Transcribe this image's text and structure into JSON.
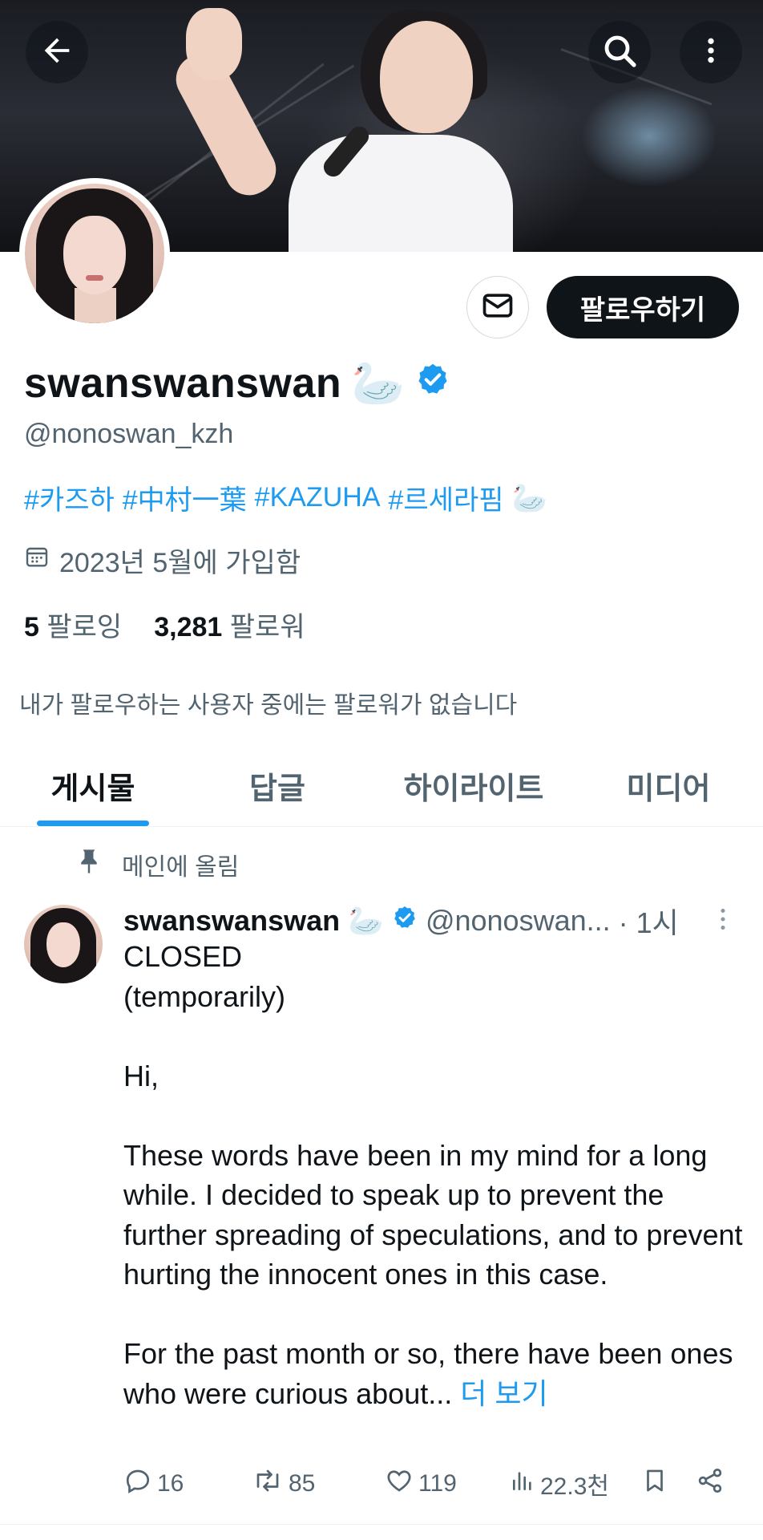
{
  "profile": {
    "display_name": "swanswanswan",
    "name_emoji": "🦢",
    "handle": "@nonoswan_kzh",
    "bio_tags": [
      "#카즈하",
      "#中村一葉",
      "#KAZUHA",
      "#르세라핌"
    ],
    "bio_emoji": "🦢",
    "joined": "2023년 5월에 가입함",
    "following_count": "5",
    "following_label": "팔로잉",
    "followers_count": "3,281",
    "followers_label": "팔로워",
    "mutual_note": "내가 팔로우하는 사용자 중에는 팔로워가 없습니다",
    "follow_button": "팔로우하기",
    "verified_color": "#1d9bf0"
  },
  "icons": {
    "back": "back-arrow-icon",
    "search": "search-icon",
    "more": "more-vertical-icon",
    "mail": "mail-icon",
    "calendar": "calendar-icon",
    "pin": "pin-icon",
    "verified": "verified-badge-icon"
  },
  "tabs": [
    {
      "label": "게시물",
      "active": true
    },
    {
      "label": "답글",
      "active": false
    },
    {
      "label": "하이라이트",
      "active": false
    },
    {
      "label": "미디어",
      "active": false
    }
  ],
  "post": {
    "pinned_label": "메인에 올림",
    "author": "swanswanswan",
    "author_emoji": "🦢",
    "handle": "@nonoswan...",
    "time": "· 1시",
    "lines": [
      "CLOSED",
      "(temporarily)",
      "",
      "Hi,",
      "",
      "These words have been in my mind for a long while. I decided to speak up to prevent the further spreading of speculations, and to prevent hurting the innocent ones in this case.",
      "",
      "For the past month or so, there have been ones who were curious about..."
    ],
    "show_more": "더 보기",
    "replies": "16",
    "reposts": "85",
    "likes": "119",
    "views": "22.3천"
  }
}
